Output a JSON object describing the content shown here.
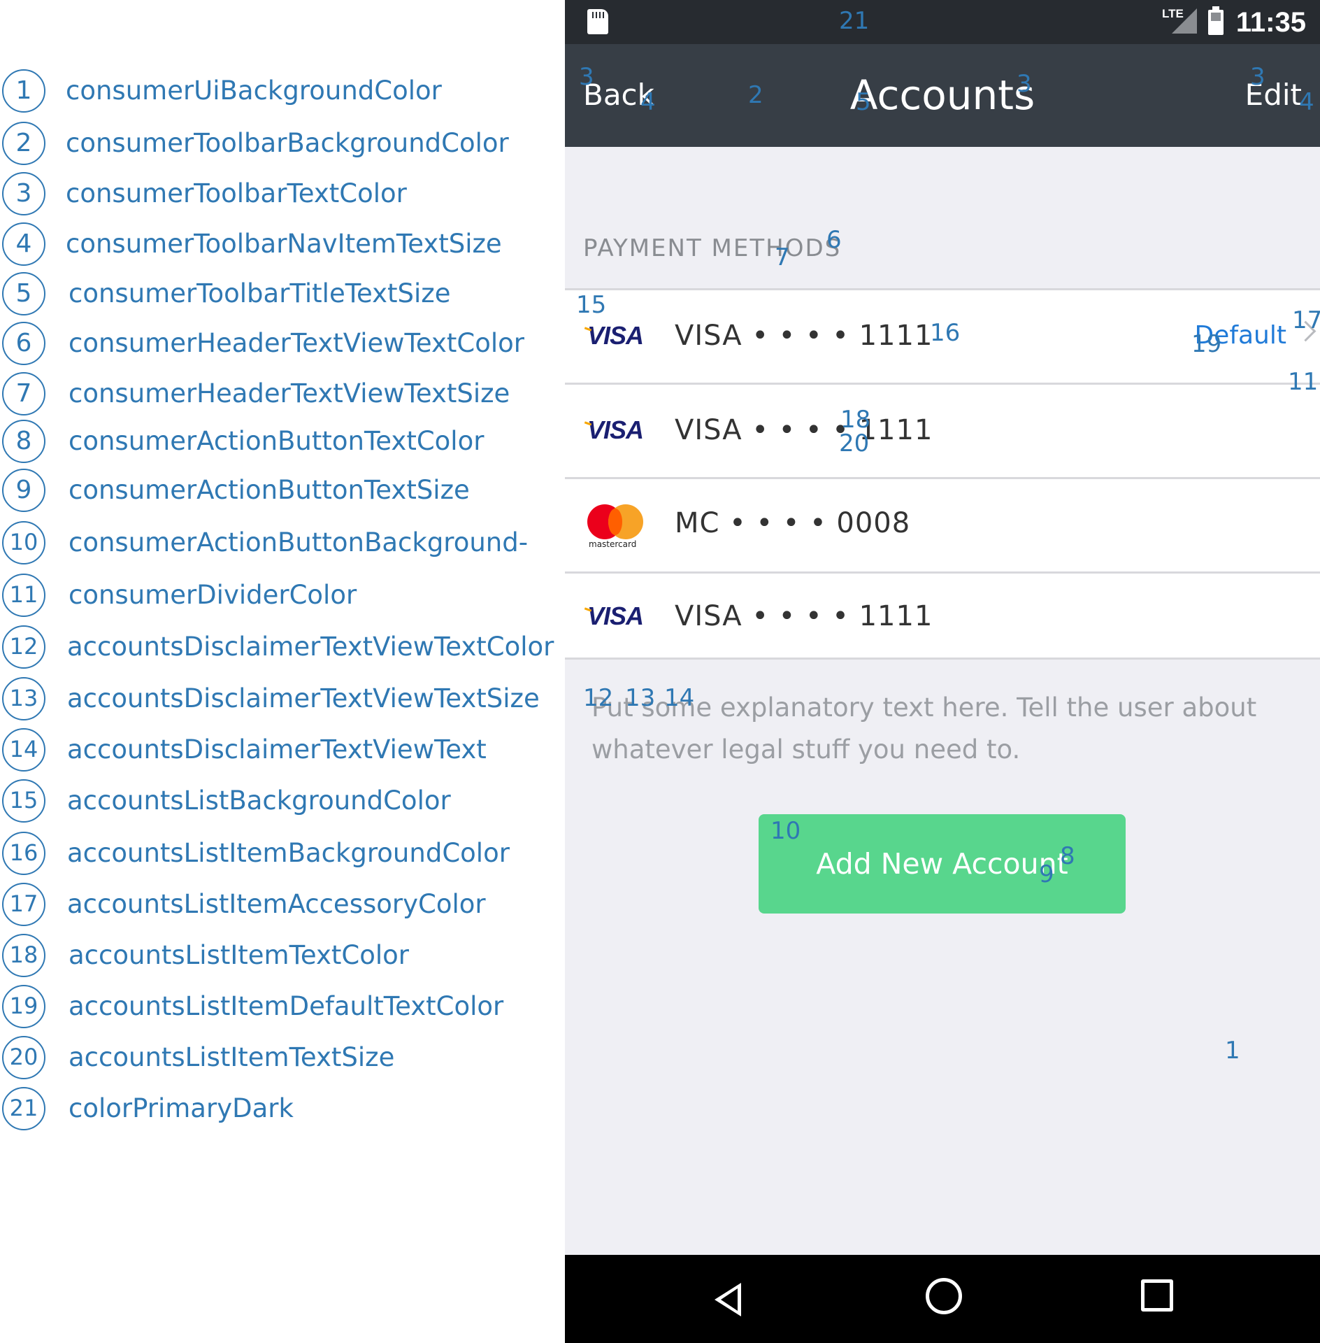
{
  "legend": [
    {
      "num": "1",
      "label": "consumerUiBackgroundColor"
    },
    {
      "num": "2",
      "label": "consumerToolbarBackgroundColor"
    },
    {
      "num": "3",
      "label": "consumerToolbarTextColor"
    },
    {
      "num": "4",
      "label": "consumerToolbarNavItemTextSize"
    },
    {
      "num": "5",
      "label": "consumerToolbarTitleTextSize"
    },
    {
      "num": "6",
      "label": "consumerHeaderTextViewTextColor"
    },
    {
      "num": "7",
      "label": "consumerHeaderTextViewTextSize"
    },
    {
      "num": "8",
      "label": "consumerActionButtonTextColor"
    },
    {
      "num": "9",
      "label": "consumerActionButtonTextSize"
    },
    {
      "num": "10",
      "label": "consumerActionButtonBackground-"
    },
    {
      "num": "11",
      "label": "consumerDividerColor"
    },
    {
      "num": "12",
      "label": "accountsDisclaimerTextViewTextColor"
    },
    {
      "num": "13",
      "label": "accountsDisclaimerTextViewTextSize"
    },
    {
      "num": "14",
      "label": "accountsDisclaimerTextViewText"
    },
    {
      "num": "15",
      "label": "accountsListBackgroundColor"
    },
    {
      "num": "16",
      "label": "accountsListItemBackgroundColor"
    },
    {
      "num": "17",
      "label": "accountsListItemAccessoryColor"
    },
    {
      "num": "18",
      "label": "accountsListItemTextColor"
    },
    {
      "num": "19",
      "label": "accountsListItemDefaultTextColor"
    },
    {
      "num": "20",
      "label": "accountsListItemTextSize"
    },
    {
      "num": "21",
      "label": "colorPrimaryDark"
    }
  ],
  "status_bar": {
    "network": "LTE",
    "time": "11:35",
    "icons": [
      "sd-card-icon",
      "signal-icon",
      "battery-icon"
    ]
  },
  "toolbar": {
    "back_label": "Back",
    "title": "Accounts",
    "edit_label": "Edit"
  },
  "section_header": "PAYMENT METHODS",
  "accounts": [
    {
      "brand": "VISA",
      "label": "VISA • • • • 1111",
      "default_label": "Default",
      "icon": "visa-logo-icon"
    },
    {
      "brand": "VISA",
      "label": "VISA • • • • 1111",
      "icon": "visa-logo-icon"
    },
    {
      "brand": "mastercard",
      "label": "MC • • • • 0008",
      "icon": "mastercard-logo-icon"
    },
    {
      "brand": "VISA",
      "label": "VISA • • • • 1111",
      "icon": "visa-logo-icon"
    }
  ],
  "disclaimer": "Put some explanatory text here. Tell the user about whatever legal stuff you need to.",
  "add_button_label": "Add New Account",
  "nav_bar": {
    "icons": [
      "back-triangle-icon",
      "home-circle-icon",
      "recents-square-icon"
    ]
  },
  "annotations": {
    "a1": "1",
    "a2": "2",
    "a3": "3",
    "a4": "4",
    "a5": "5",
    "a6": "6",
    "a7": "7",
    "a8": "8",
    "a9": "9",
    "a10": "10",
    "a11": "11",
    "a12": "12",
    "a13": "13",
    "a14": "14",
    "a15": "15",
    "a16": "16",
    "a17": "17",
    "a18": "18",
    "a19": "19",
    "a20": "20",
    "a21": "21"
  },
  "colors": {
    "legend_blue": "#2f78b3",
    "status_bar": "#272b30",
    "toolbar": "#373e46",
    "background": "#efeff4",
    "divider": "#d8d8dc",
    "default_text": "#1f7ad8",
    "button": "#58d68d"
  }
}
